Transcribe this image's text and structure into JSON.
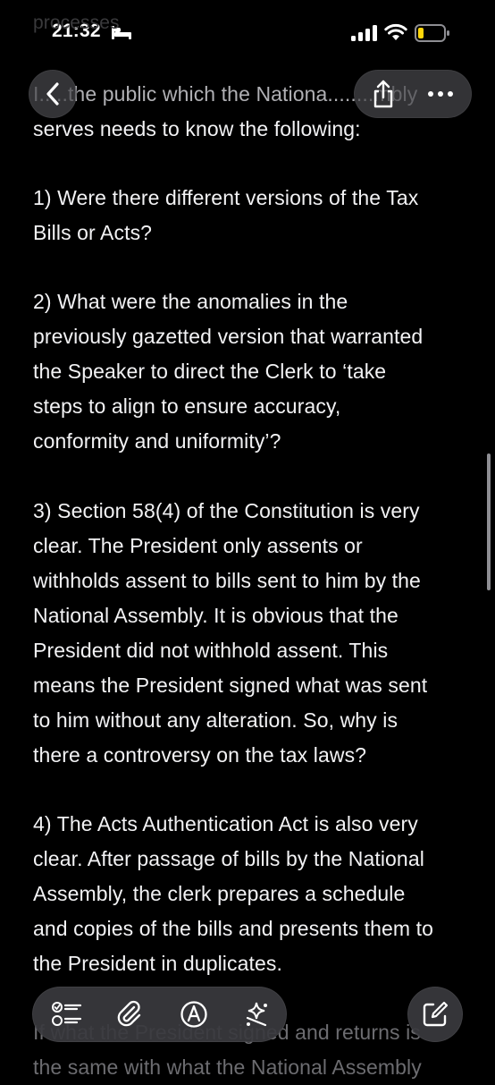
{
  "status_bar": {
    "time": "21:32"
  },
  "note": {
    "lines": [
      "processes",
      "I.....the public which the Nationa........mbly",
      "serves needs to know the following:",
      "1) Were there different versions of the Tax",
      "Bills or Acts?",
      "2) What were the anomalies in the",
      "previously gazetted version that warranted",
      "the Speaker to direct the Clerk to ‘take",
      "steps to align to ensure accuracy,",
      "conformity and uniformity’?",
      "3) Section 58(4) of the Constitution is very",
      "clear. The President only assents or",
      "withholds assent to bills sent to him by the",
      "National Assembly. It is obvious that the",
      "President did not withhold assent. This",
      "means the President signed what was sent",
      "to him without any alteration. So, why is",
      "there a controversy on the tax laws?",
      "4) The Acts Authentication Act is also very",
      "clear. After passage of bills by the National",
      "Assembly, the clerk prepares a schedule",
      "and copies of the bills and presents them to",
      "the President in duplicates.",
      "If what the President signed and returns is",
      "the same with what the National Assembly"
    ]
  },
  "icons": {
    "back": "chevron-left-icon",
    "share": "share-icon",
    "more": "ellipsis-icon",
    "checklist": "checklist-icon",
    "attach": "paperclip-icon",
    "markup": "pen-circle-icon",
    "ai": "sparkle-icon",
    "compose": "compose-icon"
  },
  "colors": {
    "background": "#000000",
    "text": "#f2f2f4",
    "button": "#46464b"
  }
}
